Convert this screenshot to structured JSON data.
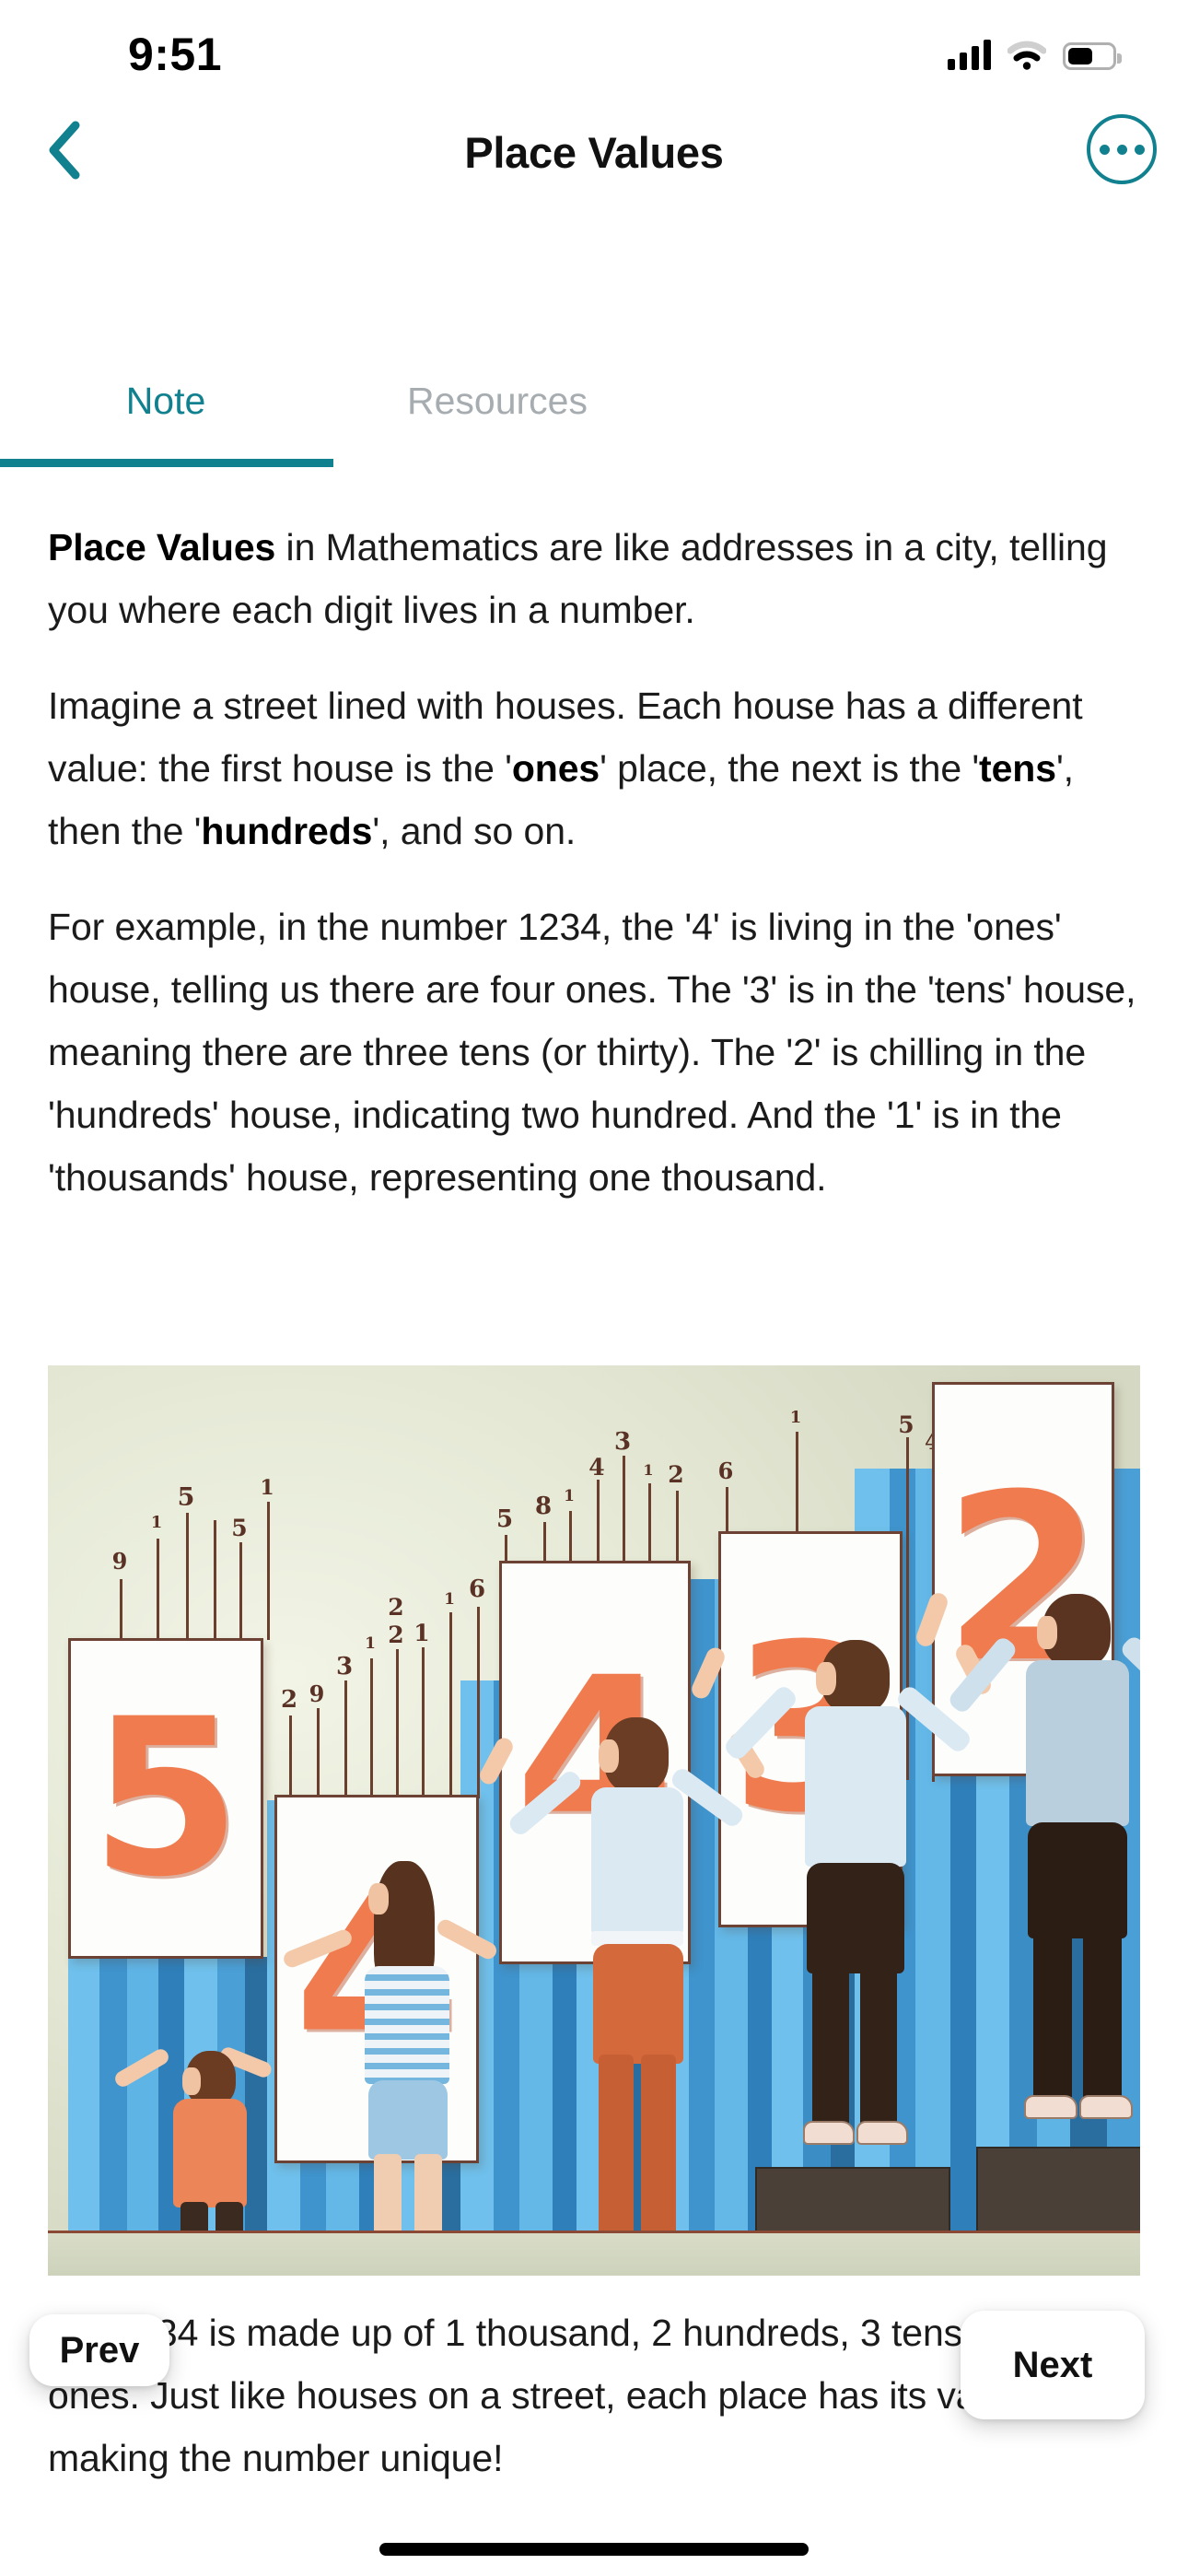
{
  "status_bar": {
    "time": "9:51",
    "icons": [
      "cellular-signal-icon",
      "wifi-icon",
      "battery-icon"
    ]
  },
  "nav_bar": {
    "back_icon": "chevron-left-icon",
    "title": "Place Values",
    "more_icon": "ellipsis-icon",
    "accent_color": "#11808F"
  },
  "tabs": {
    "items": [
      {
        "label": "Note",
        "active": true
      },
      {
        "label": "Resources",
        "active": false
      }
    ],
    "active_color": "#11808F",
    "inactive_color": "#A6ACAF"
  },
  "note": {
    "paragraphs": [
      {
        "id": "p1",
        "runs": [
          {
            "text": "Place Values",
            "bold": true
          },
          {
            "text": " in Mathematics are like addresses in a city, telling you where each digit lives in a number.",
            "bold": false
          }
        ]
      },
      {
        "id": "p2",
        "runs": [
          {
            "text": "Imagine a street lined with houses. Each house has a different value: the first house is the '",
            "bold": false
          },
          {
            "text": "ones",
            "bold": true
          },
          {
            "text": "' place, the next is the '",
            "bold": false
          },
          {
            "text": "tens",
            "bold": true
          },
          {
            "text": "', then the '",
            "bold": false
          },
          {
            "text": "hundreds",
            "bold": true
          },
          {
            "text": "', and so on.",
            "bold": false
          }
        ]
      },
      {
        "id": "p3",
        "runs": [
          {
            "text": "For example, in the number 1234, the '4' is living in the 'ones' house, telling us there are four ones. The '3' is in the 'tens' house, meaning there are three tens (or thirty). The '2' is chilling in the 'hundreds' house, indicating two hundred. And the '1' is in the 'thousands' house, representing one thousand.",
            "bold": false
          }
        ]
      },
      {
        "id": "p4",
        "runs": [
          {
            "text": "So, 1234 is made up of 1 thousand, 2 hundreds, 3 tens, and 4 ones. Just like houses on a street, each place has its value, making the number unique!",
            "bold": false
          }
        ]
      }
    ]
  },
  "illustration": {
    "alt": "Five people of increasing height holding orange number placards against a blue bar chart",
    "background_color": "#D6DAC5",
    "card_number_color": "#EF7B4E",
    "bar_color": "#4FA8DD",
    "cards": [
      "5",
      "4",
      "4",
      "3",
      "2"
    ],
    "stem_labels": [
      "9",
      "5",
      "1",
      "5",
      "1",
      "2",
      "9",
      "3",
      "1",
      "2",
      "2",
      "1",
      "6",
      "5",
      "8",
      "1",
      "4",
      "3",
      "1",
      "2",
      "6",
      "1",
      "5",
      "4"
    ]
  },
  "page_nav": {
    "prev_label": "Prev",
    "next_label": "Next"
  },
  "home_indicator": "home-indicator"
}
